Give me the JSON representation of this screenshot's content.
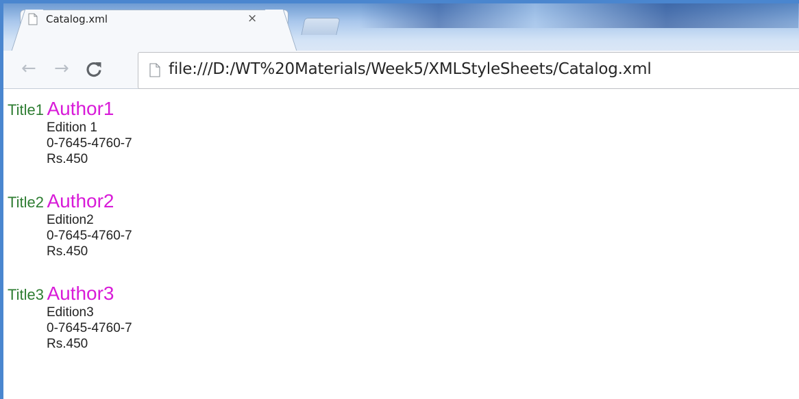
{
  "browser": {
    "tab": {
      "title": "Catalog.xml",
      "close_symbol": "×",
      "icon": "page-icon"
    },
    "toolbar": {
      "back_symbol": "←",
      "forward_symbol": "→",
      "reload_icon": "reload-icon"
    },
    "address": {
      "icon": "page-icon",
      "url": "file:///D:/WT%20Materials/Week5/XMLStyleSheets/Catalog.xml"
    }
  },
  "catalog": {
    "books": [
      {
        "title": "Title1",
        "author": "Author1",
        "edition": "Edition 1",
        "isbn": "0-7645-4760-7",
        "price": "Rs.450"
      },
      {
        "title": "Title2",
        "author": "Author2",
        "edition": "Edition2",
        "isbn": "0-7645-4760-7",
        "price": "Rs.450"
      },
      {
        "title": "Title3",
        "author": "Author3",
        "edition": "Edition3",
        "isbn": "0-7645-4760-7",
        "price": "Rs.450"
      }
    ]
  },
  "colors": {
    "title": "#2e7d32",
    "author": "#d81bd8",
    "text": "#222222",
    "window_frame": "#4a86cf"
  }
}
